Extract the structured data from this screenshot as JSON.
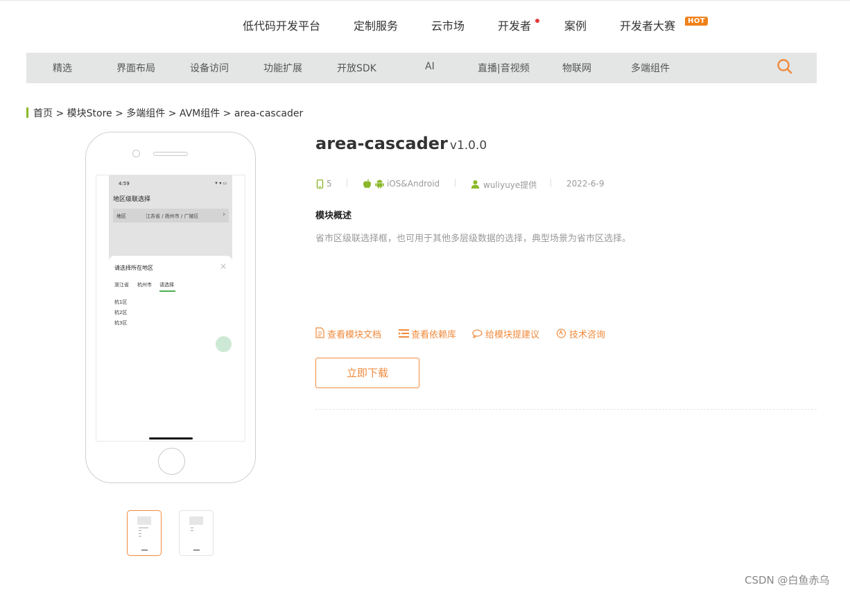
{
  "top_nav": {
    "items": [
      "低代码开发平台",
      "定制服务",
      "云市场",
      "开发者",
      "案例",
      "开发者大赛"
    ],
    "hot_badge": "HOT"
  },
  "category_bar": {
    "items": [
      "精选",
      "界面布局",
      "设备访问",
      "功能扩展",
      "开放SDK",
      "AI",
      "直播|音视频",
      "物联网",
      "多端组件"
    ]
  },
  "breadcrumb": "首页 > 模块Store > 多端组件 > AVM组件 > area-cascader",
  "phone_screen": {
    "time": "4:59",
    "status_icons": "✈ ▾ ▭",
    "title": "地区级联选择",
    "row_label": "地区",
    "row_value": "江苏省 / 扬州市 / 广陵区",
    "chevron": "›",
    "sheet_title": "请选择所在地区",
    "sheet_close": "×",
    "tabs": [
      "浙江省",
      "杭州市",
      "请选择"
    ],
    "items": [
      "杭1区",
      "杭2区",
      "杭3区"
    ]
  },
  "module": {
    "name": "area-cascader",
    "version": "v1.0.0",
    "count": "5",
    "platform": "iOS&Android",
    "provider": "wuliyuye提供",
    "date": "2022-6-9",
    "section_title": "模块概述",
    "description": "省市区级联选择框，也可用于其他多层级数据的选择，典型场景为省市区选择。",
    "links": [
      "查看模块文档",
      "查看依赖库",
      "给模块提建议",
      "技术咨询"
    ],
    "download_label": "立即下载"
  },
  "watermark": "CSDN @白鱼赤乌",
  "colors": {
    "accent": "#f08a3c",
    "green": "#8bb82a",
    "category_bg": "#e4e5e5",
    "red_dot": "#e4393c"
  }
}
